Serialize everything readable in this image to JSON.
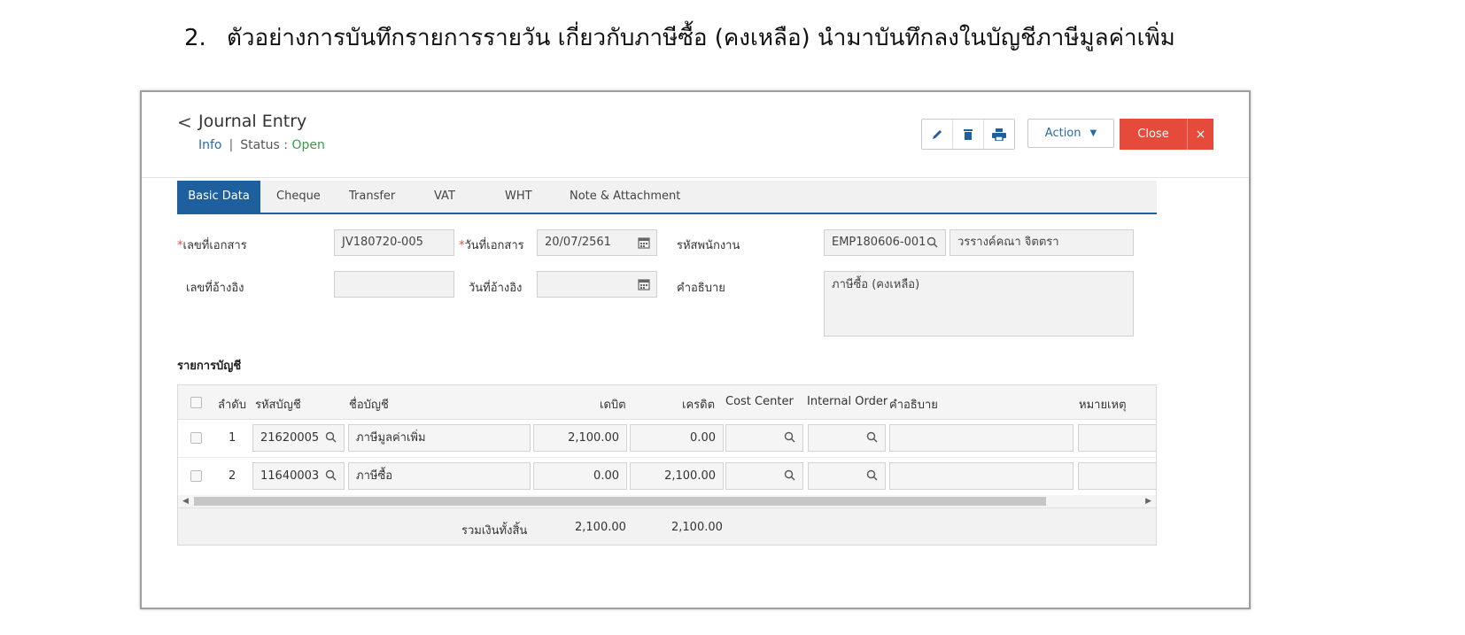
{
  "heading": {
    "number": "2.",
    "text": "ตัวอย่างการบันทึกรายการรายวัน เกี่ยวกับภาษีซื้อ (คงเหลือ) นำมาบันทึกลงในบัญชีภาษีมูลค่าเพิ่ม"
  },
  "header": {
    "back_glyph": "<",
    "title": "Journal Entry",
    "info_link": "Info",
    "separator": "|",
    "status_label": "Status :",
    "status_value": "Open",
    "status_color": "#3b9a4a"
  },
  "toolbar": {
    "icons": [
      "pencil-icon",
      "trash-icon",
      "print-icon"
    ],
    "action_label": "Action",
    "close_label": "Close",
    "close_x": "×",
    "close_color": "#e64a3b"
  },
  "tabs": [
    {
      "label": "Basic Data",
      "active": true
    },
    {
      "label": "Cheque",
      "active": false
    },
    {
      "label": "Transfer",
      "active": false
    },
    {
      "label": "VAT",
      "active": false
    },
    {
      "label": "WHT",
      "active": false
    },
    {
      "label": "Note & Attachment",
      "active": false
    }
  ],
  "form": {
    "doc_no_label": "เลขที่เอกสาร",
    "doc_no_value": "JV180720-005",
    "doc_date_label": "วันที่เอกสาร",
    "doc_date_value": "20/07/2561",
    "employee_code_label": "รหัสพนักงาน",
    "employee_code_value": "EMP180606-001",
    "employee_name_value": "วรรางค์คณา จิตตรา",
    "ref_no_label": "เลขที่อ้างอิง",
    "ref_no_value": "",
    "ref_date_label": "วันที่อ้างอิง",
    "ref_date_value": "",
    "description_label": "คำอธิบาย",
    "description_value": "ภาษีซื้อ (คงเหลือ)",
    "required_mark": "*"
  },
  "accounts": {
    "section_title": "รายการบัญชี",
    "columns": {
      "seq": "ลำดับ",
      "code": "รหัสบัญชี",
      "name": "ชื่อบัญชี",
      "debit": "เดบิต",
      "credit": "เครดิต",
      "cost_center": "Cost Center",
      "internal_order": "Internal Order",
      "description": "คำอธิบาย",
      "remark": "หมายเหตุ"
    },
    "rows": [
      {
        "seq": "1",
        "code": "21620005",
        "name": "ภาษีมูลค่าเพิ่ม",
        "debit": "2,100.00",
        "credit": "0.00"
      },
      {
        "seq": "2",
        "code": "11640003",
        "name": "ภาษีซื้อ",
        "debit": "0.00",
        "credit": "2,100.00"
      }
    ],
    "total_label": "รวมเงินทั้งสิ้น",
    "total_debit": "2,100.00",
    "total_credit": "2,100.00"
  }
}
